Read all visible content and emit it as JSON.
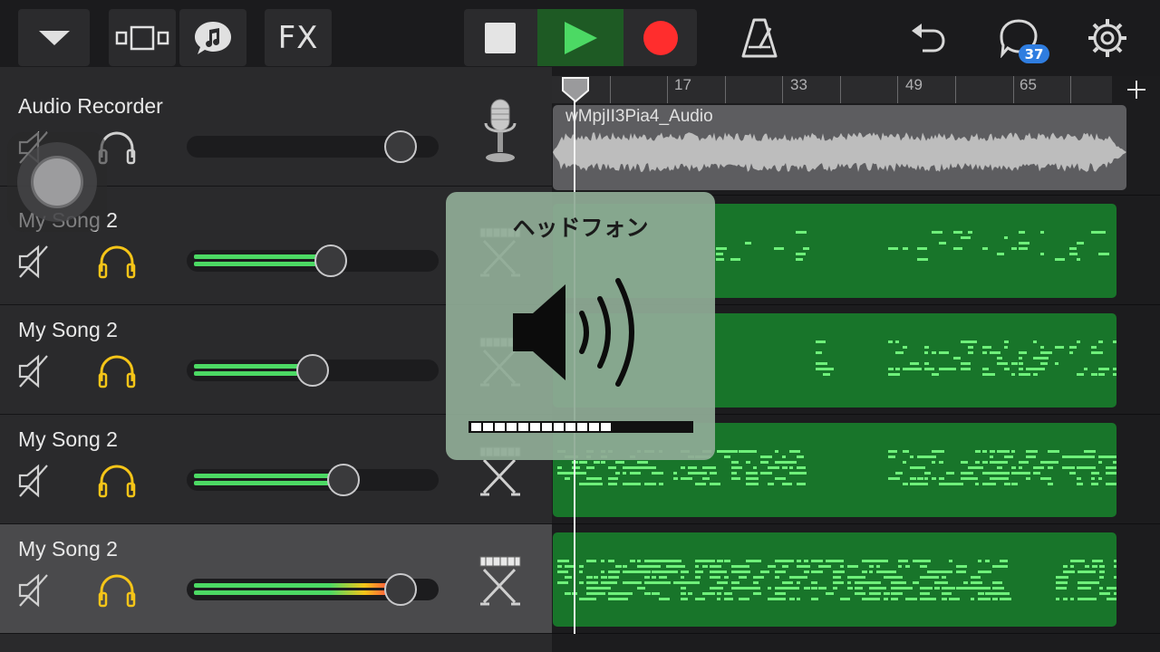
{
  "toolbar": {
    "fx_label": "FX",
    "count_badge": "37"
  },
  "tracks": [
    {
      "name": "Audio Recorder",
      "volume": 0.93,
      "muted": false,
      "headphone_active": false,
      "instrument_icon": "microphone-icon",
      "selected": false
    },
    {
      "name": "My Song 2",
      "volume": 0.59,
      "muted": false,
      "headphone_active": true,
      "instrument_icon": "keyboard-icon",
      "selected": false
    },
    {
      "name": "My Song 2",
      "volume": 0.5,
      "muted": false,
      "headphone_active": true,
      "instrument_icon": "keyboard-icon",
      "selected": false
    },
    {
      "name": "My Song 2",
      "volume": 0.65,
      "muted": false,
      "headphone_active": true,
      "instrument_icon": "keyboard-icon",
      "selected": false
    },
    {
      "name": "My Song 2",
      "volume": 0.93,
      "muted": false,
      "headphone_active": true,
      "instrument_icon": "keyboard-icon",
      "selected": true
    }
  ],
  "ruler": {
    "labels": [
      "17",
      "33",
      "49",
      "65"
    ]
  },
  "regions": {
    "audio_name": "wMpjII3Pia4_Audio"
  },
  "hud": {
    "title": "ヘッドフォン",
    "level": 0.8,
    "segments_total": 15
  },
  "colors": {
    "accent_green": "#4cd964",
    "record_red": "#ff2d2d",
    "headphone_yellow": "#f5c518",
    "midi_region": "#18752a",
    "badge_blue": "#2f7de0"
  }
}
